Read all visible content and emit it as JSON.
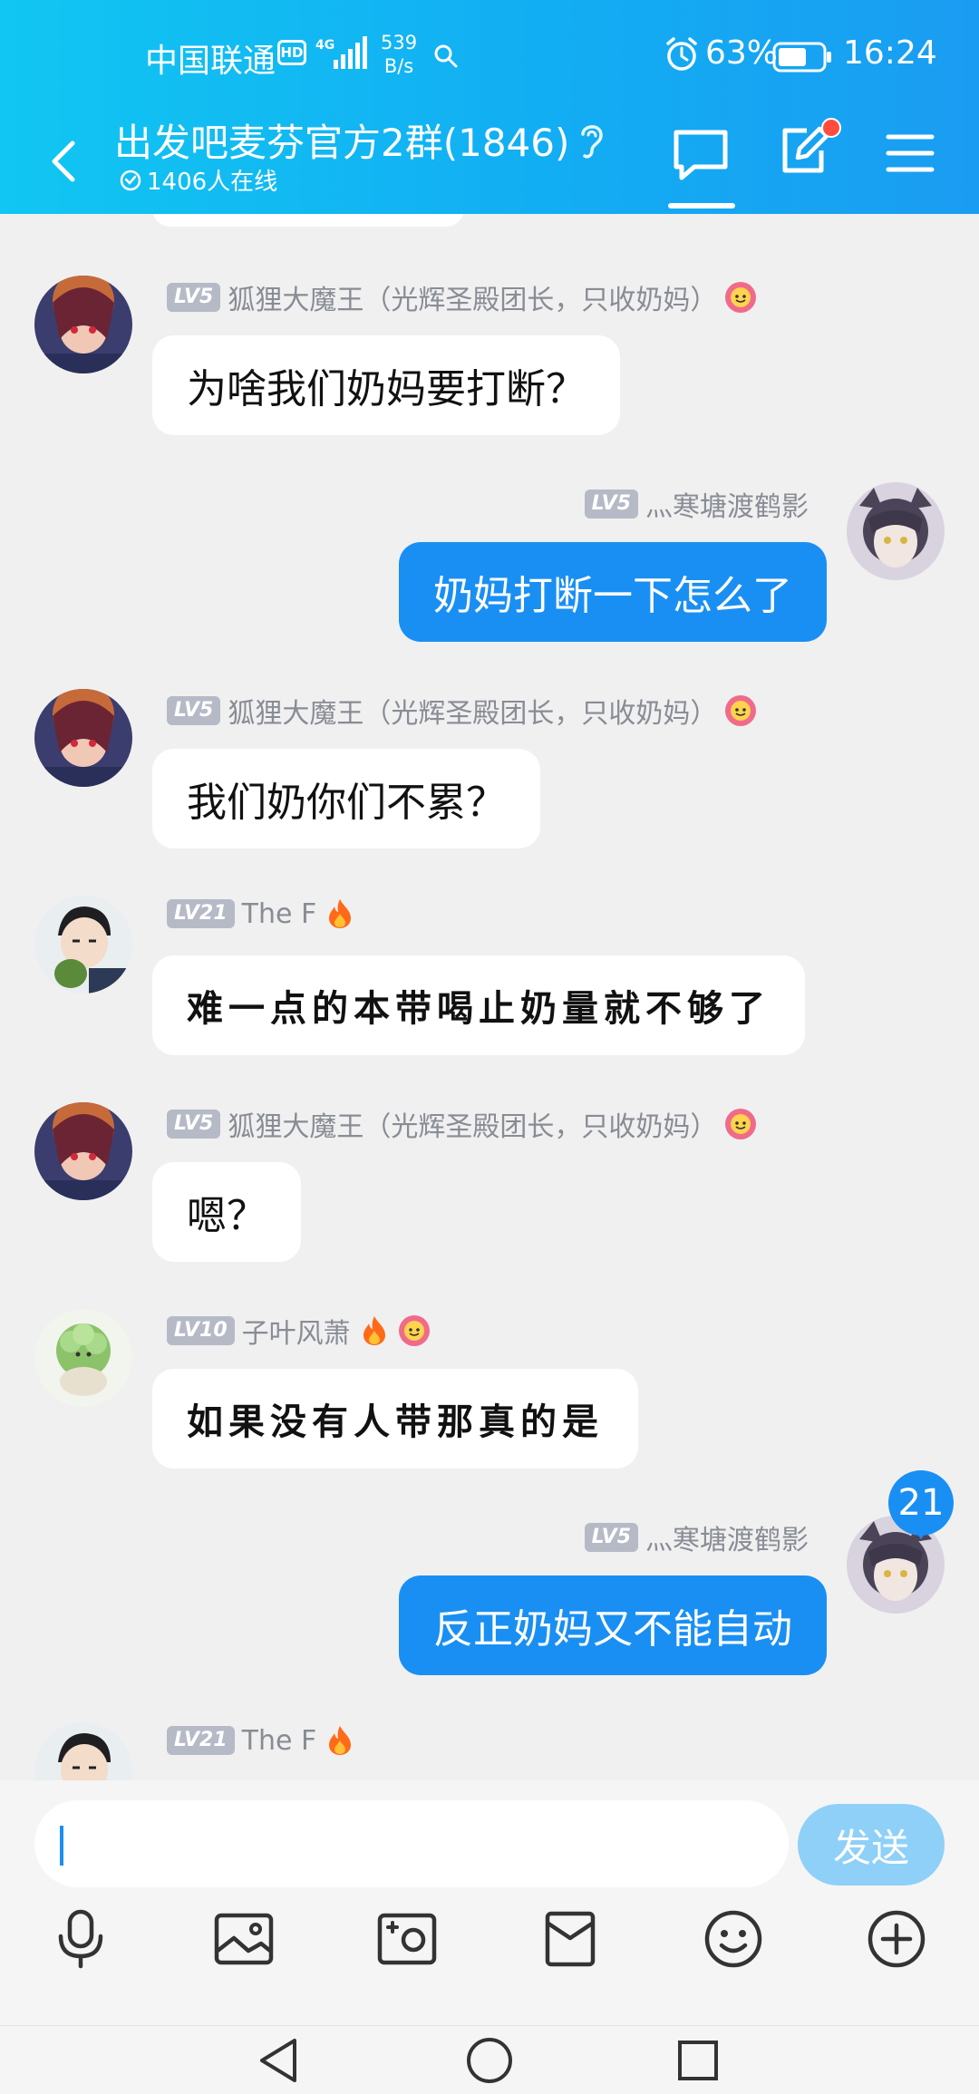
{
  "status_bar": {
    "carrier": "中国联通",
    "hd": "HD",
    "network": "4G",
    "speed_value": "539",
    "speed_unit": "B/s",
    "battery": "63%",
    "time": "16:24"
  },
  "header": {
    "title": "出发吧麦芬官方2群(1846)",
    "online": "1406人在线"
  },
  "messages": [
    {
      "side": "left",
      "level": "LV5",
      "sender": "狐狸大魔王（光辉圣殿团长，只收奶妈）",
      "text": "为啥我们奶妈要打断？"
    },
    {
      "side": "right",
      "level": "LV5",
      "sender": "灬寒塘渡鹤影",
      "text": "奶妈打断一下怎么了"
    },
    {
      "side": "left",
      "level": "LV5",
      "sender": "狐狸大魔王（光辉圣殿团长，只收奶妈）",
      "text": "我们奶你们不累？"
    },
    {
      "side": "left",
      "level": "LV21",
      "sender": "The F",
      "text": "难一点的本带喝止奶量就不够了"
    },
    {
      "side": "left",
      "level": "LV5",
      "sender": "狐狸大魔王（光辉圣殿团长，只收奶妈）",
      "text": "嗯？"
    },
    {
      "side": "left",
      "level": "LV10",
      "sender": "子叶风萧",
      "text": "如果没有人带那真的是"
    },
    {
      "side": "right",
      "level": "LV5",
      "sender": "灬寒塘渡鹤影",
      "text": "反正奶妈又不能自动"
    },
    {
      "side": "left",
      "level": "LV21",
      "sender": "The F",
      "text": ""
    }
  ],
  "unread_count": "21",
  "input": {
    "value": "",
    "placeholder": ""
  },
  "send_label": "发送",
  "toolbar_icons": [
    "microphone-icon",
    "image-icon",
    "camera-icon",
    "red-packet-icon",
    "emoji-icon",
    "plus-icon"
  ],
  "nav_icons": [
    "back-triangle-icon",
    "home-circle-icon",
    "recents-square-icon"
  ],
  "colors": {
    "header_gradient_start": "#11c6f2",
    "header_gradient_end": "#1a9cf2",
    "my_bubble": "#1a8ff3",
    "other_bubble": "#ffffff",
    "send_button": "#8ed0f8",
    "notification_dot": "#ff4d3d",
    "background": "#f0f0f0"
  }
}
